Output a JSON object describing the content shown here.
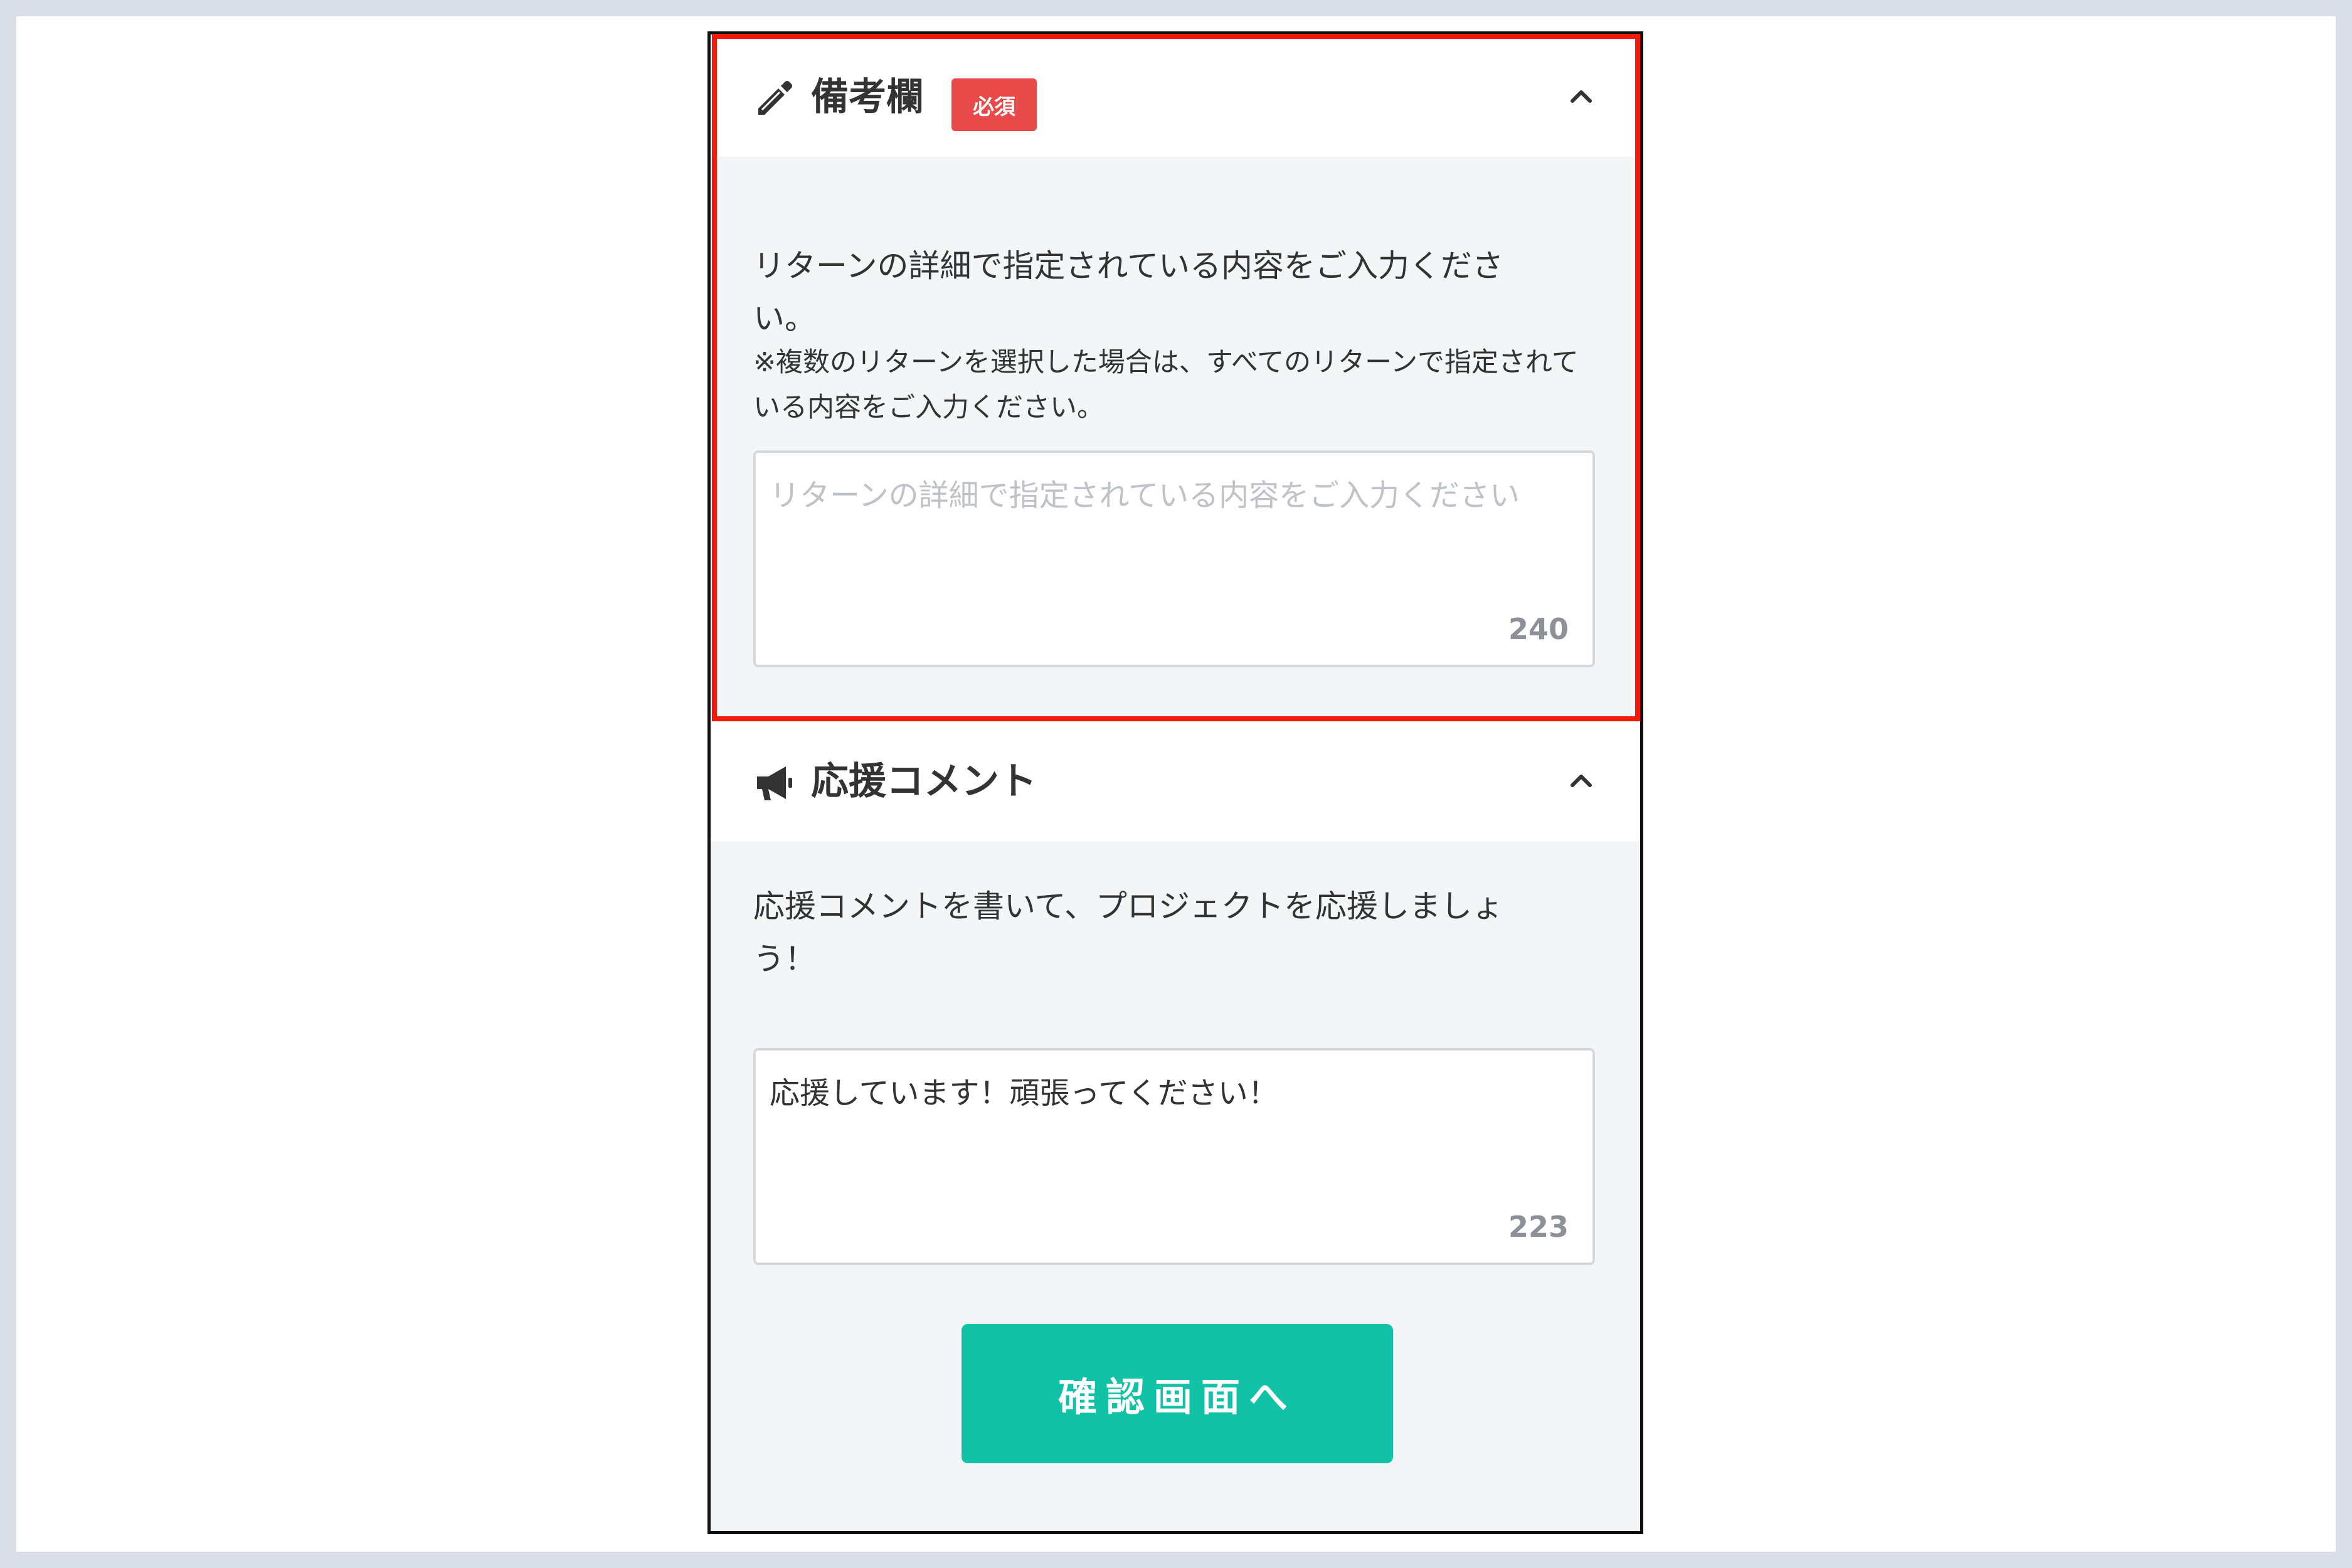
{
  "remarks": {
    "title": "備考欄",
    "badge": "必須",
    "description": "リターンの詳細で指定されている内容をご入力ください。",
    "note": "※複数のリターンを選択した場合は、すべてのリターンで指定されている内容をご入力ください。",
    "placeholder": "リターンの詳細で指定されている内容をご入力ください",
    "value": "",
    "counter": "240"
  },
  "support": {
    "title": "応援コメント",
    "description": "応援コメントを書いて、プロジェクトを応援しましょう！",
    "value": "応援しています！頑張ってください！",
    "counter": "223"
  },
  "submit_label": "確認画面へ",
  "icons": {
    "remarks": "pencil-icon",
    "support": "megaphone-icon",
    "collapse": "chevron-up-icon"
  },
  "colors": {
    "required_badge": "#e84a4a",
    "submit_button": "#11c2a6",
    "highlight_border": "#f21a0a"
  }
}
